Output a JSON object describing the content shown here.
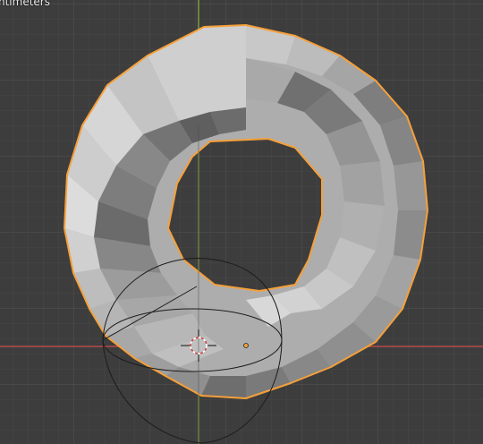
{
  "viewport": {
    "unit_label": "ntimeters",
    "selected_object": "torus",
    "colors": {
      "background": "#3d3d3d",
      "grid_minor": "#454545",
      "grid_major": "#505050",
      "axis_x": "#b84a4a",
      "axis_y": "#7f9a3f",
      "selection_outline": "#f5a03a",
      "origin_dot": "#f2a03a"
    },
    "icons": {
      "cursor": "3d-cursor-icon",
      "origin": "object-origin-icon",
      "light": "spot-light-icon"
    }
  }
}
